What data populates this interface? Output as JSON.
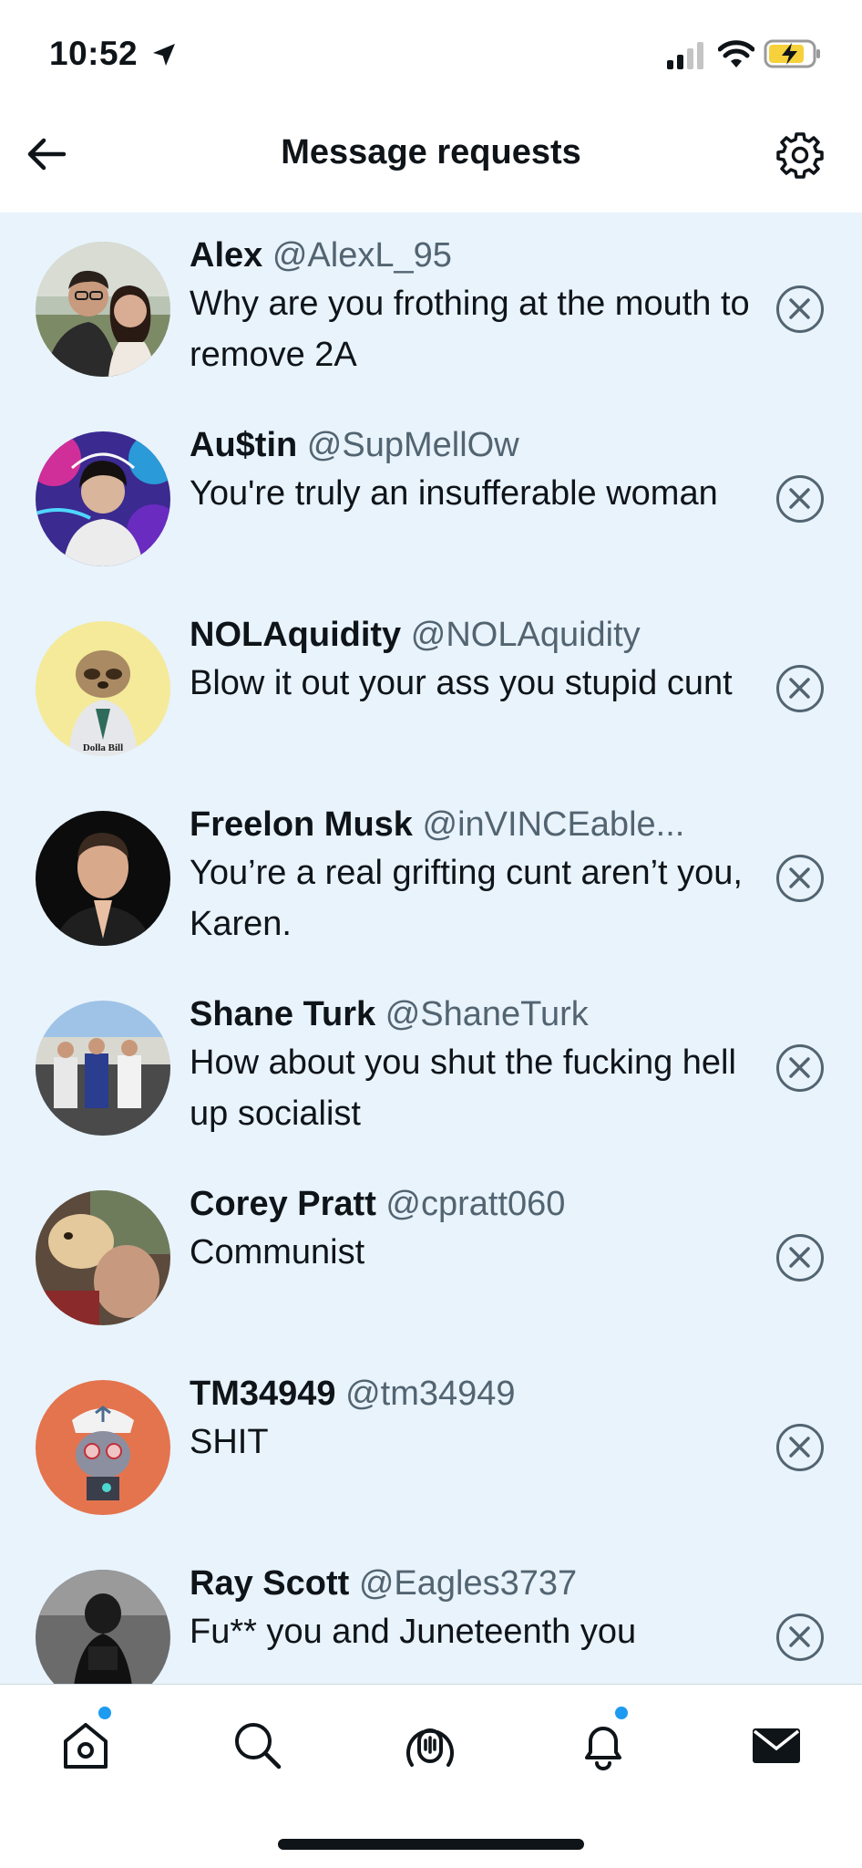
{
  "status_bar": {
    "time": "10:52"
  },
  "header": {
    "title": "Message requests"
  },
  "requests": [
    {
      "name": "Alex",
      "handle": "@AlexL_95",
      "message": "Why are you frothing at the mouth to remove 2A"
    },
    {
      "name": "Au$tin",
      "handle": "@SupMellOw",
      "message": "You're truly an insufferable woman"
    },
    {
      "name": "NOLAquidity",
      "handle": "@NOLAquidity",
      "message": "Blow it out your ass you stupid cunt",
      "avatar_text": "Dolla Bill"
    },
    {
      "name": "Freelon Musk",
      "handle": "@inVINCEable...",
      "message": "You’re a real grifting cunt aren’t you, Karen."
    },
    {
      "name": "Shane Turk",
      "handle": "@ShaneTurk",
      "message": "How about you shut the fucking hell up socialist"
    },
    {
      "name": "Corey Pratt",
      "handle": "@cpratt060",
      "message": "Communist"
    },
    {
      "name": "TM34949",
      "handle": "@tm34949",
      "message": "SHIT"
    },
    {
      "name": "Ray Scott",
      "handle": "@Eagles3737",
      "message": "Fu** you and Juneteenth you"
    }
  ],
  "colors": {
    "list_background": "#e8f3fc",
    "handle_gray": "#536471",
    "accent_blue": "#1d9bf0",
    "text_primary": "#0f1419"
  },
  "nav": {
    "items": [
      "home-icon",
      "search-icon",
      "spaces-icon",
      "notifications-icon",
      "messages-icon"
    ],
    "active": "messages-icon"
  }
}
